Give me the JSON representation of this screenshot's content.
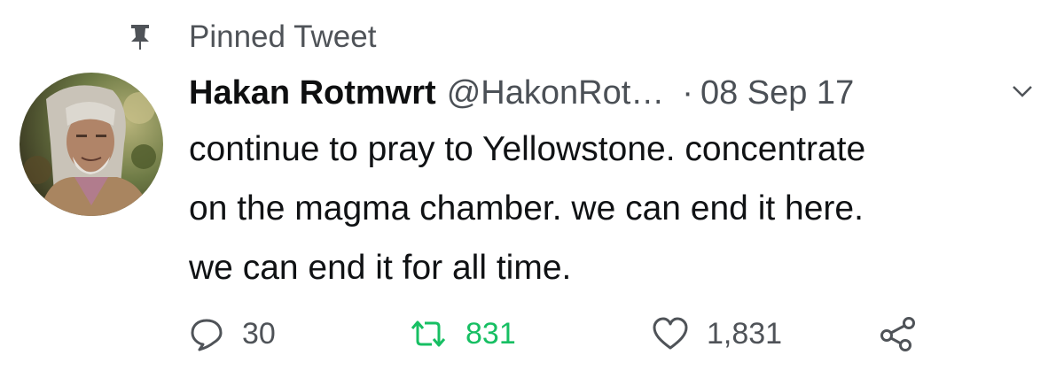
{
  "pinned": {
    "label": "Pinned Tweet",
    "icon": "pin-icon"
  },
  "author": {
    "display_name": "Hakan Rotmwrt",
    "handle": "@HakonRot…",
    "separator": "·",
    "timestamp": "08 Sep 17",
    "avatar_icon": "avatar"
  },
  "tweet": {
    "lines": [
      "continue to pray to Yellowstone. concentrate",
      "on the magma chamber. we can end it here.",
      "we can end it for all time."
    ]
  },
  "actions": {
    "reply_count": "30",
    "retweet_count": "831",
    "like_count": "1,831",
    "retweet_color": "#17bf63",
    "icons": [
      "reply-icon",
      "retweet-icon",
      "like-icon",
      "share-icon",
      "chevron-down-icon"
    ]
  }
}
